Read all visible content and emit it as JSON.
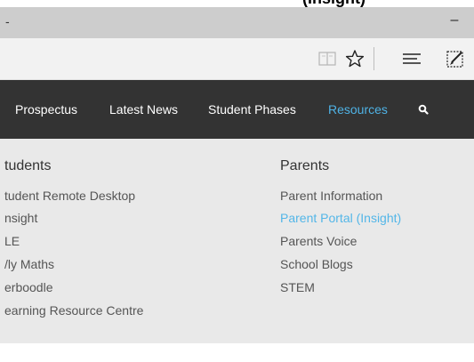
{
  "top_strip": {
    "text": "(Insight)"
  },
  "titlebar": {
    "left_glyph": "-",
    "minimize_glyph": "–"
  },
  "toolbar": {
    "icons": [
      "reading-view-icon",
      "favorites-star-icon",
      "hub-icon",
      "web-note-icon"
    ]
  },
  "navbar": {
    "items": [
      {
        "label": "Prospectus"
      },
      {
        "label": "Latest News"
      },
      {
        "label": "Student Phases"
      },
      {
        "label": "Resources",
        "active": true
      }
    ],
    "search_icon": "search-icon"
  },
  "dropdown": {
    "students": {
      "heading": "tudents",
      "links": [
        "tudent Remote Desktop",
        "nsight",
        "LE",
        "/ly Maths",
        "erboodle",
        "earning Resource Centre"
      ]
    },
    "parents": {
      "heading": "Parents",
      "links": [
        "Parent Information",
        "Parent Portal (Insight)",
        "Parents Voice",
        "School Blogs",
        "STEM"
      ],
      "active_link": "Parent Portal (Insight)"
    }
  },
  "colors": {
    "navbar_bg": "#333333",
    "accent": "#4fb3e6",
    "dropdown_bg": "#e9e9e9"
  }
}
